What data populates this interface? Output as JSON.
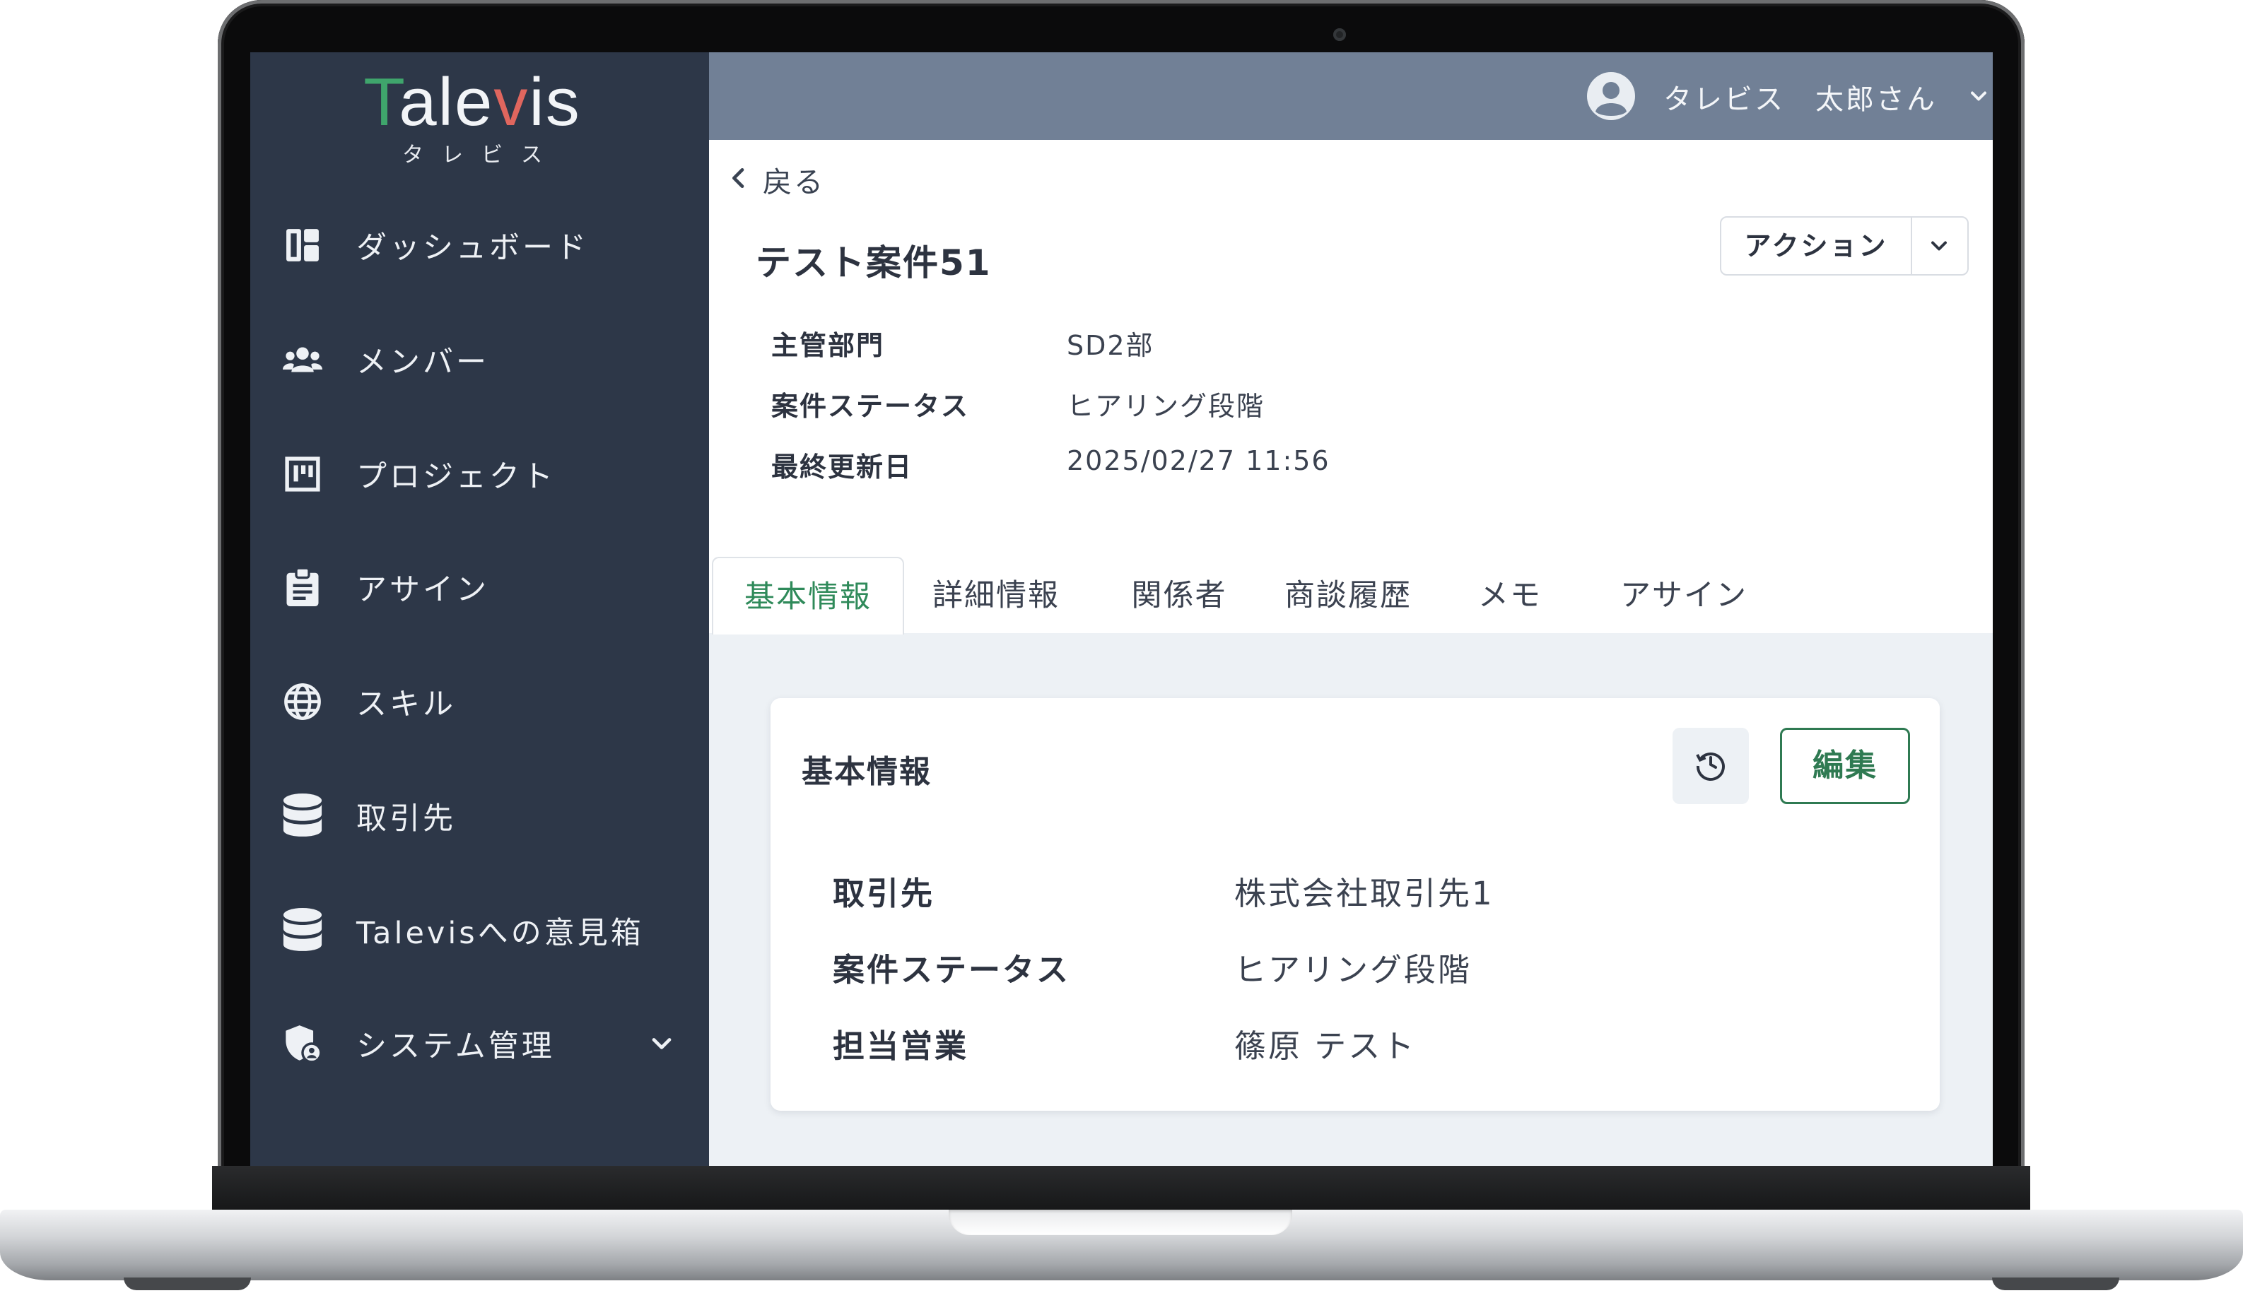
{
  "colors": {
    "sidebar_bg": "#2d3748",
    "topbar_bg": "#718096",
    "accent_green": "#2f7a52",
    "logo_t": "#3fa56c",
    "logo_i_dot": "#e0665e"
  },
  "logo": {
    "word": "Talevis",
    "kana": "タレビス"
  },
  "sidebar": {
    "items": [
      {
        "label": "ダッシュボード",
        "icon": "dashboard-icon"
      },
      {
        "label": "メンバー",
        "icon": "users-icon"
      },
      {
        "label": "プロジェクト",
        "icon": "kanban-icon"
      },
      {
        "label": "アサイン",
        "icon": "clipboard-icon"
      },
      {
        "label": "スキル",
        "icon": "globe-icon"
      },
      {
        "label": "取引先",
        "icon": "database-icon"
      },
      {
        "label": "Talevisへの意見箱",
        "icon": "database-icon"
      },
      {
        "label": "システム管理",
        "icon": "shield-user-icon",
        "has_submenu": true
      }
    ]
  },
  "header": {
    "user_name": "タレビス　太郎さん"
  },
  "page": {
    "back_label": "戻る",
    "title": "テスト案件51",
    "action_label": "アクション",
    "summary": [
      {
        "label": "主管部門",
        "value": "SD2部"
      },
      {
        "label": "案件ステータス",
        "value": "ヒアリング段階"
      },
      {
        "label": "最終更新日",
        "value": "2025/02/27 11:56"
      }
    ]
  },
  "tabs": [
    {
      "label": "基本情報",
      "active": true
    },
    {
      "label": "詳細情報"
    },
    {
      "label": "関係者"
    },
    {
      "label": "商談履歴"
    },
    {
      "label": "メモ"
    },
    {
      "label": "アサイン"
    }
  ],
  "card": {
    "title": "基本情報",
    "edit_label": "編集",
    "rows": [
      {
        "label": "取引先",
        "value": "株式会社取引先1"
      },
      {
        "label": "案件ステータス",
        "value": "ヒアリング段階"
      },
      {
        "label": "担当営業",
        "value": "篠原 テスト"
      }
    ]
  }
}
